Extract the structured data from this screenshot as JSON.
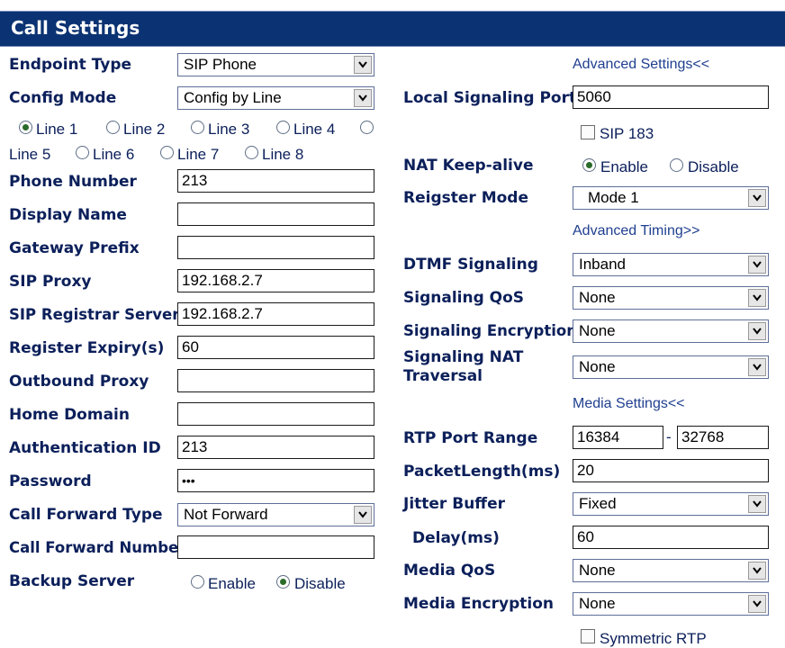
{
  "header": {
    "title": "Call Settings"
  },
  "left": {
    "endpoint_type": {
      "label": "Endpoint Type",
      "value": "SIP Phone"
    },
    "config_mode": {
      "label": "Config Mode",
      "value": "Config by Line"
    },
    "lines": [
      "Line 1",
      "Line 2",
      "Line 3",
      "Line 4",
      "Line 5",
      "Line 6",
      "Line 7",
      "Line 8"
    ],
    "selected_line": "Line 1",
    "phone_number": {
      "label": "Phone Number",
      "value": "213"
    },
    "display_name": {
      "label": "Display Name",
      "value": ""
    },
    "gateway_prefix": {
      "label": "Gateway Prefix",
      "value": ""
    },
    "sip_proxy": {
      "label": "SIP Proxy",
      "value": "192.168.2.7"
    },
    "sip_registrar": {
      "label": "SIP Registrar Server",
      "value": "192.168.2.7"
    },
    "register_expiry": {
      "label": "Register Expiry(s)",
      "value": "60"
    },
    "outbound_proxy": {
      "label": "Outbound Proxy",
      "value": ""
    },
    "home_domain": {
      "label": "Home Domain",
      "value": ""
    },
    "auth_id": {
      "label": "Authentication ID",
      "value": "213"
    },
    "password": {
      "label": "Password",
      "value": "•••"
    },
    "call_forward_type": {
      "label": "Call Forward Type",
      "value": "Not Forward"
    },
    "call_forward_number": {
      "label": "Call Forward Number",
      "value": ""
    },
    "backup_server": {
      "label": "Backup Server",
      "enable": "Enable",
      "disable": "Disable",
      "selected": "Disable"
    }
  },
  "right": {
    "advanced_settings_link": "Advanced Settings<<",
    "local_signaling_port": {
      "label": "Local Signaling Port",
      "value": "5060"
    },
    "sip183": {
      "label": "SIP 183",
      "checked": false
    },
    "nat_keepalive": {
      "label": "NAT Keep-alive",
      "enable": "Enable",
      "disable": "Disable",
      "selected": "Enable"
    },
    "register_mode": {
      "label": "Reigster Mode",
      "value": "Mode 1"
    },
    "advanced_timing_link": "Advanced Timing>>",
    "dtmf_signaling": {
      "label": "DTMF Signaling",
      "value": "Inband"
    },
    "signaling_qos": {
      "label": "Signaling QoS",
      "value": "None"
    },
    "signaling_encryption": {
      "label": "Signaling Encryption",
      "value": "None"
    },
    "signaling_nat_traversal": {
      "label_line1": "Signaling NAT",
      "label_line2": "Traversal",
      "value": "None"
    },
    "media_settings_link": "Media Settings<<",
    "rtp_port_range": {
      "label": "RTP Port Range",
      "from": "16384",
      "separator": "-",
      "to": "32768"
    },
    "packet_length": {
      "label": "PacketLength(ms)",
      "value": "20"
    },
    "jitter_buffer": {
      "label": "Jitter Buffer",
      "value": "Fixed"
    },
    "delay": {
      "label": "Delay(ms)",
      "value": "60"
    },
    "media_qos": {
      "label": "Media QoS",
      "value": "None"
    },
    "media_encryption": {
      "label": "Media Encryption",
      "value": "None"
    },
    "symmetric_rtp": {
      "label": "Symmetric RTP",
      "checked": false
    }
  }
}
